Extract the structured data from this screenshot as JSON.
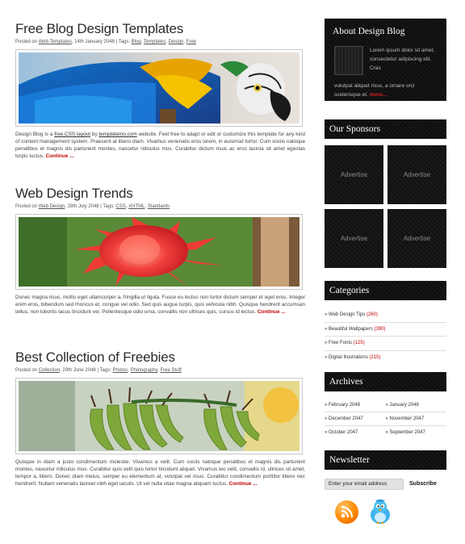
{
  "posts": [
    {
      "title": "Free Blog Design Templates",
      "meta_prefix": "Posted on ",
      "meta_link1": "Web Templates",
      "meta_date": ", 14th January 2048 | Tags: ",
      "tags": [
        "Blog",
        "Templates",
        "Design",
        "Free"
      ],
      "body_1": "Design Blog is a ",
      "body_link1": "free CSS layout",
      "body_2": " by ",
      "body_link2": "templatemo.com",
      "body_3": " website. Feel free to adapt or edit or customize this template for any kind of content management system. Praesent at libero diam. Vivamus venenatis eros lorem, in euismod tortor. Cum sociis natoque penatibus et magnis dis parturient montes, nascetur ridiculus mus. Curabitur dictum risus ac eros lacinia sit amet egestas turpis luctus. ",
      "continue": "Continue ..."
    },
    {
      "title": "Web Design Trends",
      "meta_prefix": "Posted on ",
      "meta_link1": "Web Design",
      "meta_date": ", 28th July 2048 | Tags: ",
      "tags": [
        "CSS",
        "XHTML",
        "Standards"
      ],
      "body": "Donec magna risus, mollis eget ullamcorper a, fringilla ut ligula. Fusce eu lectus non tortor dictum semper et eget eros. Integer enim eros, bibendum sed rhoncus et, congue vel odio. Sed quis augue turpis, quis vehicula nibh. Quisque hendrerit accumsan tellus, non lobortis lacus tincidunt vel. Pellentesque odio urna, convallis non ultrices quis, cursus id lectus. ",
      "continue": "Continue ..."
    },
    {
      "title": "Best Collection of Freebies",
      "meta_prefix": "Posted on ",
      "meta_link1": "Collection",
      "meta_date": ", 20th June 2048 | Tags: ",
      "tags": [
        "Photos",
        "Photography",
        "Free Stuff"
      ],
      "body": "Quisque in diam a justo condimentum molestie. Vivamus a velit. Cum sociis natoque penatibus et magnis dis parturient montes, nascetur ridiculus mus. Curabitur quis velit quis tortor tincidunt aliquet. Vivamus leo velit, convallis id, ultrices sit amet, tempor a, libero. Donec diam metus, semper eu elementum at, volutpat vel risus. Curabitur condimentum porttitor libero nec hendrerit. Nullam venenatis laoreet nibh eget iaculis. Ut vel nulla vitae magna aliquam luctus. ",
      "continue": "Continue ..."
    }
  ],
  "sidebar": {
    "about_title": "About Design Blog",
    "about_text_a": "Lorem ipsum dolor sit amet, consectetur adipiscing elit. Cras",
    "about_text_b": "volutpat aliquet risus, a ornare orci scelerisque et.",
    "about_more": "more...",
    "sponsors_title": "Our Sponsors",
    "advertise_label": "Advertise",
    "categories_title": "Categories",
    "categories": [
      {
        "name": "Web Design Tips",
        "count": "(260)"
      },
      {
        "name": "Beautiful Wallpapers",
        "count": "(390)"
      },
      {
        "name": "Free Fonts",
        "count": "(125)"
      },
      {
        "name": "Digital Illustrations",
        "count": "(215)"
      }
    ],
    "archives_title": "Archives",
    "archives": [
      [
        "February 2048",
        "January 2048"
      ],
      [
        "December 2047",
        "November 2047"
      ],
      [
        "October 2047",
        "September 2047"
      ]
    ],
    "newsletter_title": "Newsletter",
    "newsletter_placeholder": "Enter your email address",
    "subscribe_label": "Subscribe"
  },
  "icons": {
    "rss": "rss-icon",
    "twitter": "twitter-bird-icon"
  }
}
